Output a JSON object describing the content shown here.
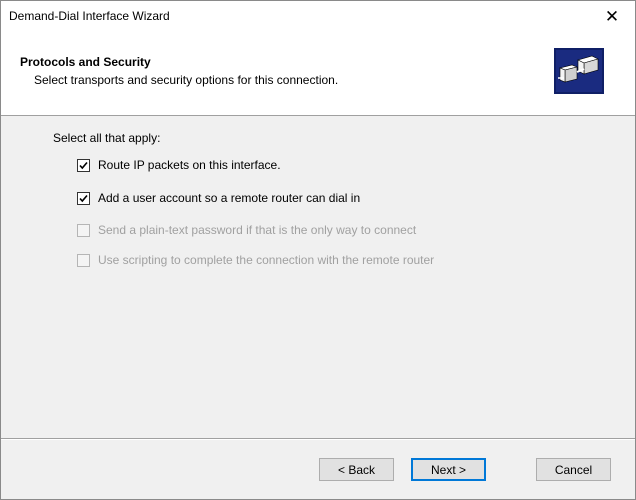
{
  "window": {
    "title": "Demand-Dial Interface Wizard",
    "close_glyph": "✕"
  },
  "header": {
    "title": "Protocols and Security",
    "subtitle": "Select transports and security options for this connection.",
    "icon": "network-connection-icon"
  },
  "content": {
    "prompt": "Select all that apply:",
    "options": [
      {
        "label": "Route IP packets on this interface.",
        "checked": true,
        "enabled": true
      },
      {
        "label": "Add a user account so a remote router can dial in",
        "checked": true,
        "enabled": true
      },
      {
        "label": "Send a plain-text password if that is the only way to connect",
        "checked": false,
        "enabled": false
      },
      {
        "label": "Use scripting to complete the connection with the remote router",
        "checked": false,
        "enabled": false
      }
    ]
  },
  "buttons": {
    "back": "< Back",
    "next": "Next >",
    "cancel": "Cancel"
  },
  "colors": {
    "default_button_border": "#0078d7",
    "disabled_text": "#a0a0a0"
  }
}
